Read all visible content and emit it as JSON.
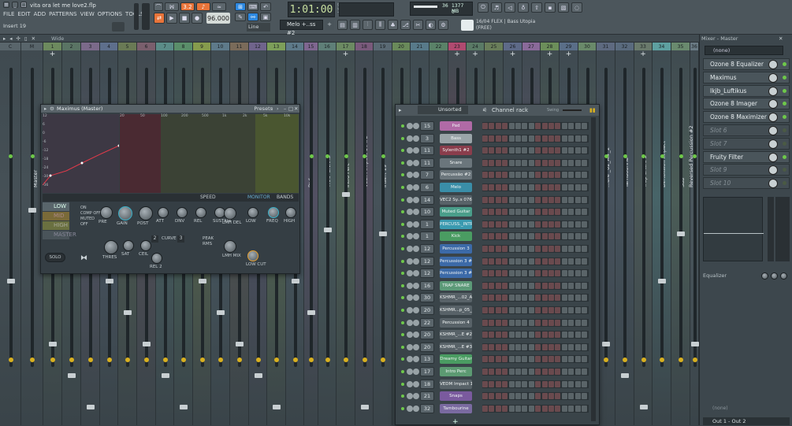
{
  "topbar": {
    "title": "vita ora let me love2.flp",
    "menu": [
      "FILE",
      "EDIT",
      "ADD",
      "PATTERNS",
      "VIEW",
      "OPTIONS",
      "TOOLS",
      "?"
    ],
    "insert_label": "Insert 19",
    "time": "1:01:00",
    "time_unit": "B:S:T",
    "bpm": "96.000",
    "pattern": "Melo +..ss #2",
    "snap": "Line",
    "cpu": "36",
    "mem": "1377 MB",
    "mem_sub": "0",
    "plugin_info": "16/04 FLEX | Bass Utopia",
    "plugin_info2": "(FREE)",
    "wide_label": "Wide"
  },
  "mixer_strips": [
    {
      "head": "C",
      "name": "",
      "color": "#59656b"
    },
    {
      "head": "M",
      "name": "Master",
      "color": "#59656b"
    },
    {
      "head": "1",
      "name": "",
      "color": "#6d8a5e"
    },
    {
      "head": "2",
      "name": "",
      "color": "#5a7464"
    },
    {
      "head": "3",
      "name": "",
      "color": "#7b6a8a"
    },
    {
      "head": "4",
      "name": "",
      "color": "#5e6f8c"
    },
    {
      "head": "5",
      "name": "",
      "color": "#6a7a55"
    },
    {
      "head": "6",
      "name": "",
      "color": "#7a5f6d"
    },
    {
      "head": "7",
      "name": "",
      "color": "#5b8c88"
    },
    {
      "head": "8",
      "name": "",
      "color": "#5a8e6a"
    },
    {
      "head": "9",
      "name": "",
      "color": "#869c4d"
    },
    {
      "head": "10",
      "name": "",
      "color": "#5e7a8a"
    },
    {
      "head": "11",
      "name": "",
      "color": "#7a6b5a"
    },
    {
      "head": "12",
      "name": "",
      "color": "#70648c"
    },
    {
      "head": "13",
      "name": "",
      "color": "#7d9f5a"
    },
    {
      "head": "14",
      "name": "",
      "color": "#5e7a8a"
    },
    {
      "head": "15",
      "name": "Pad",
      "color": "#7f6690"
    },
    {
      "head": "16",
      "name": "TRAP SNARE",
      "color": "#5f7f78"
    },
    {
      "head": "17",
      "name": "Intro Perc",
      "color": "#6c8a62"
    },
    {
      "head": "18",
      "name": "VEDM Impact 14 #2",
      "color": "#7a5a7c"
    },
    {
      "head": "19",
      "name": "Insert 19",
      "color": "#5a6a74"
    },
    {
      "head": "20",
      "name": "",
      "color": "#6a8a5a"
    },
    {
      "head": "21",
      "name": "",
      "color": "#587a8a"
    },
    {
      "head": "22",
      "name": "",
      "color": "#5a8268"
    },
    {
      "head": "23",
      "name": "",
      "color": "#b04a70"
    },
    {
      "head": "24",
      "name": "",
      "color": "#5a7a66"
    },
    {
      "head": "25",
      "name": "",
      "color": "#6a7e5a"
    },
    {
      "head": "26",
      "name": "",
      "color": "#5e6a88"
    },
    {
      "head": "27",
      "name": "",
      "color": "#8a6a9a"
    },
    {
      "head": "28",
      "name": "",
      "color": "#6c8e5a"
    },
    {
      "head": "29",
      "name": "",
      "color": "#5a6e88"
    },
    {
      "head": "30",
      "name": "",
      "color": "#6a8a6a"
    },
    {
      "head": "31",
      "name": "...ure _02_A#_2",
      "color": "#5e6a80"
    },
    {
      "head": "32",
      "name": "Tambourine",
      "color": "#5a6b7e"
    },
    {
      "head": "33",
      "name": "Trap Snare 2",
      "color": "#6a7a6c"
    },
    {
      "head": "34",
      "name": "Bertolision Impact",
      "color": "#5ea0a0"
    },
    {
      "head": "35",
      "name": "Sub",
      "color": "#6a8a6e"
    },
    {
      "head": "36",
      "name": "Reversed Percussion #2",
      "color": "#6a7a84"
    }
  ],
  "mixer_panel": {
    "title": "Mixer - Master",
    "input": "(none)",
    "slots": [
      {
        "label": "Ozone 8 Equalizer",
        "empty": false
      },
      {
        "label": "Maximus",
        "empty": false
      },
      {
        "label": "Ikjb_Luftikus",
        "empty": false
      },
      {
        "label": "Ozone 8 Imager",
        "empty": false
      },
      {
        "label": "Ozone 8 Maximizer",
        "empty": false
      },
      {
        "label": "Slot 6",
        "empty": true
      },
      {
        "label": "Slot 7",
        "empty": true
      },
      {
        "label": "Fruity Filter",
        "empty": false
      },
      {
        "label": "Slot 9",
        "empty": true
      },
      {
        "label": "Slot 10",
        "empty": true
      }
    ],
    "eq_label": "Equalizer",
    "output_none": "(none)",
    "output": "Out 1 - Out 2"
  },
  "maximus": {
    "title": "Maximus (Master)",
    "presets": "Presets",
    "bands": [
      "LOW",
      "MID",
      "HIGH",
      "MASTER"
    ],
    "options": [
      "ON",
      "COMP OFF",
      "MUTED",
      "OFF"
    ],
    "tab_speed": "SPEED",
    "tab_monitor": "MONITOR",
    "tab_bands": "BANDS",
    "knobs": [
      "PRE",
      "GAIN",
      "POST",
      "ATT",
      "DNV",
      "REL",
      "SUSTAIN",
      "LMH DEL",
      "LOW",
      "FREQ",
      "HIGH",
      "THRES",
      "SAT",
      "CEIL",
      "LMH MIX",
      "LOW CUT",
      "REL 2"
    ],
    "curve_label": "CURVE",
    "curve_vals": [
      "2",
      "3"
    ],
    "peak": "PEAK",
    "rms": "RMS",
    "solo": "SOLO",
    "freq_ticks": [
      "20",
      "50",
      "100",
      "200",
      "500",
      "1k",
      "2k",
      "5k",
      "10k"
    ],
    "db_ticks": [
      "12",
      "6",
      "0",
      "-6",
      "-12",
      "-18",
      "-24",
      "-30",
      "-36"
    ]
  },
  "channel_rack": {
    "title": "Channel rack",
    "filter": "Unsorted",
    "swing": "Swing",
    "rows": [
      {
        "num": "15",
        "name": "Pad",
        "color": "#b06aa6"
      },
      {
        "num": "3",
        "name": "Bass",
        "color": "#9aa4a8"
      },
      {
        "num": "11",
        "name": "Sylenth1 #2",
        "color": "#8a3d4c"
      },
      {
        "num": "11",
        "name": "Snare",
        "color": "#6b767c"
      },
      {
        "num": "7",
        "name": "Percussão #2",
        "color": "#6b767c"
      },
      {
        "num": "6",
        "name": "Melo",
        "color": "#3a8ea8"
      },
      {
        "num": "14",
        "name": "VEC2 Sy..s 076 C",
        "color": "#586268"
      },
      {
        "num": "10",
        "name": "Muted Guitar",
        "color": "#4a9e8a"
      },
      {
        "num": "1",
        "name": "PERCUSS._INTRO",
        "color": "#3a9ab0"
      },
      {
        "num": "1",
        "name": "Kick",
        "color": "#4a9c62"
      },
      {
        "num": "12",
        "name": "Percussion 3",
        "color": "#3c6aa8"
      },
      {
        "num": "12",
        "name": "Percussion 3 #3",
        "color": "#3c6aa8"
      },
      {
        "num": "12",
        "name": "Percussion 3 #2",
        "color": "#3c6aa8"
      },
      {
        "num": "16",
        "name": "TRAP SNARE",
        "color": "#5c9a78"
      },
      {
        "num": "30",
        "name": "KSHMR_...02_A#",
        "color": "#586268"
      },
      {
        "num": "20",
        "name": "KSHMR...p_05_E",
        "color": "#586268"
      },
      {
        "num": "22",
        "name": "Percussion 4",
        "color": "#586268"
      },
      {
        "num": "20",
        "name": "KSHMR_...E #2",
        "color": "#586268"
      },
      {
        "num": "20",
        "name": "KSHMR_...E #3",
        "color": "#586268"
      },
      {
        "num": "13",
        "name": "Dreamy Guitar",
        "color": "#4a9c62"
      },
      {
        "num": "17",
        "name": "Intro Perc",
        "color": "#5c9a72"
      },
      {
        "num": "18",
        "name": "VEDM Impact 14",
        "color": "#586268"
      },
      {
        "num": "21",
        "name": "Snaps",
        "color": "#7a5a9e"
      },
      {
        "num": "32",
        "name": "Tambourine",
        "color": "#7a6aa0"
      }
    ]
  }
}
